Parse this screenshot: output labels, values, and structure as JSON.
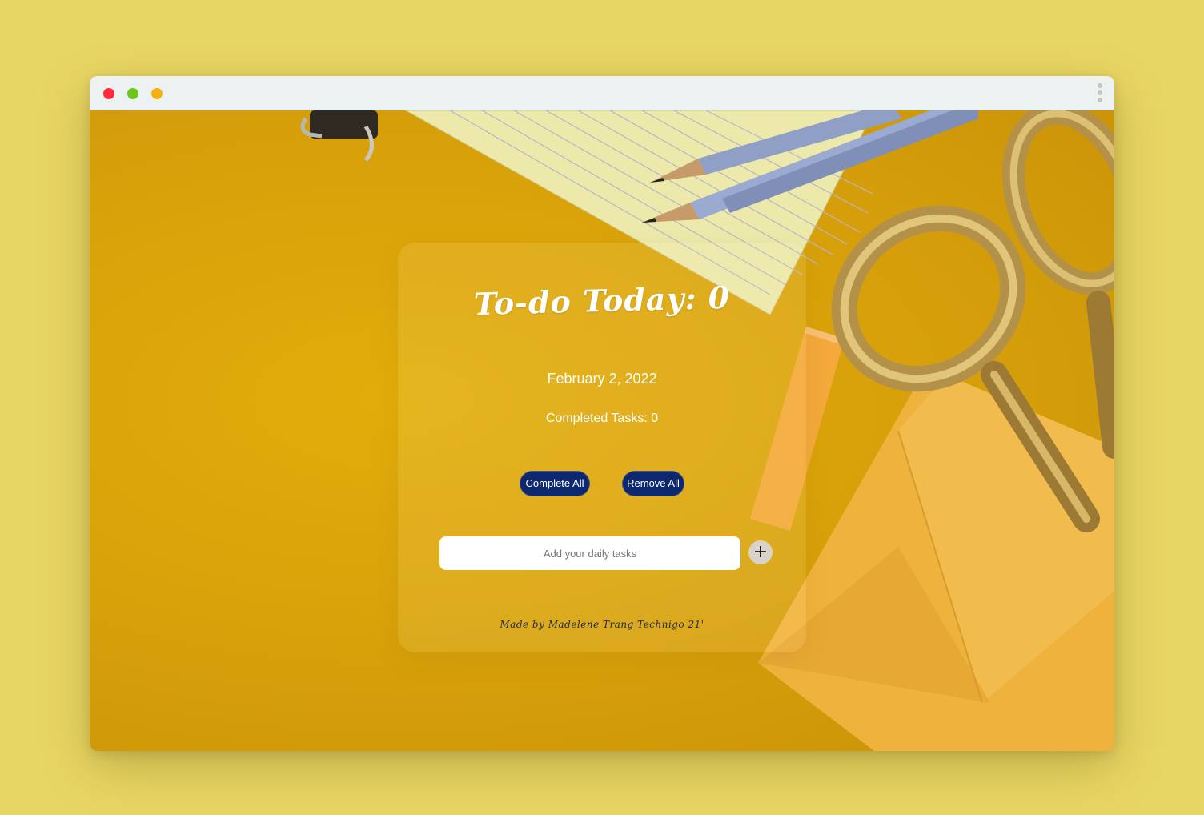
{
  "window": {
    "controls": [
      "close",
      "minimize",
      "maximize"
    ],
    "menu_icon": "kebab-menu-icon"
  },
  "todo": {
    "title": "To-do Today: 0",
    "date": "February 2, 2022",
    "completed_tasks": "Completed Tasks: 0",
    "complete_all_label": "Complete All",
    "remove_all_label": "Remove All",
    "input_placeholder": "Add your daily tasks",
    "add_button_label": "+",
    "footer": "Made by Madelene Trang Technigo 21'"
  },
  "colors": {
    "page_background": "#e8d664",
    "scene_yellow": "#d9a20a",
    "button_navy": "#0e2870",
    "traffic_red": "#ff2b3b",
    "traffic_green": "#6bc51d",
    "traffic_yellow": "#f7b012"
  }
}
